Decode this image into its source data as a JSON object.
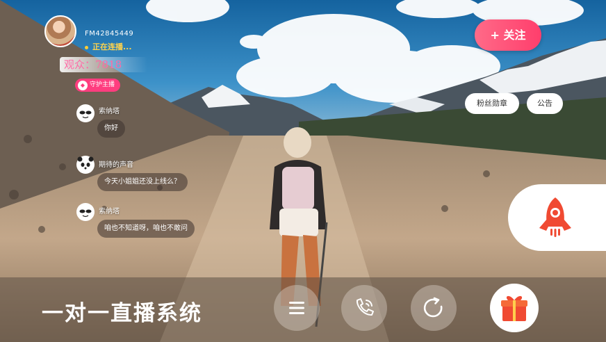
{
  "room": {
    "id": "FM42845449",
    "status": "正在连播...",
    "viewers": "观众：7818",
    "guard_badge": "守护主播"
  },
  "actions": {
    "follow_label": "+ 关注",
    "fan_badge_label": "粉丝勋章",
    "notice_label": "公告"
  },
  "chat": [
    {
      "name": "索纳塔",
      "message": "你好"
    },
    {
      "name": "期待的声音",
      "message": "今天小姐姐还没上线么？"
    },
    {
      "name": "索纳塔",
      "message": "咱也不知道呀，咱也不敢问"
    }
  ],
  "bottom": {
    "brand": "一对一直播系统",
    "buttons": [
      "menu-icon",
      "phone-icon",
      "refresh-icon",
      "gift-icon"
    ]
  },
  "colors": {
    "accent_pink": "#ff3e6c",
    "rocket_red": "#f04a32",
    "status_yellow": "#ffd34d"
  }
}
